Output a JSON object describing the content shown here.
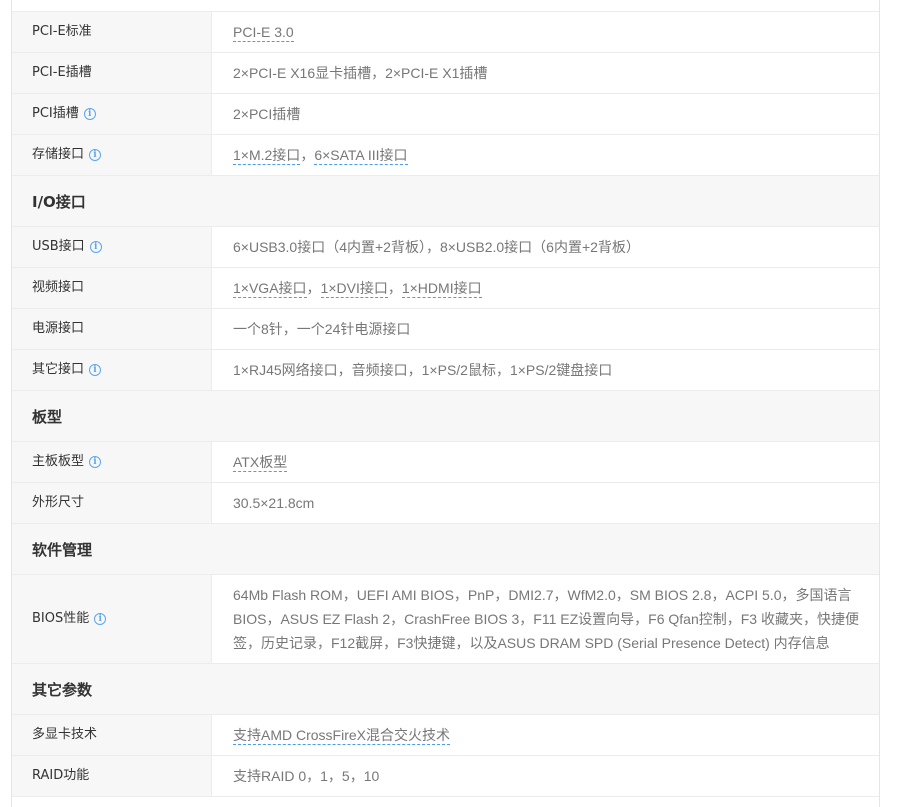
{
  "rows_top": [
    {
      "label": "PCI-E标准",
      "value": "PCI-E 3.0",
      "info": false
    },
    {
      "label": "PCI-E插槽",
      "value": "2×PCI-E X16显卡插槽，2×PCI-E X1插槽",
      "info": false
    },
    {
      "label": "PCI插槽",
      "value": "2×PCI插槽",
      "info": true
    },
    {
      "label": "存储接口",
      "value_links": [
        "1×M.2接口",
        "6×SATA III接口"
      ],
      "separator": "，",
      "info": true
    }
  ],
  "section_io": {
    "title": "I/O接口",
    "rows": [
      {
        "label": "USB接口",
        "value": "6×USB3.0接口（4内置+2背板），8×USB2.0接口（6内置+2背板）",
        "info": true
      },
      {
        "label": "视频接口",
        "value_links": [
          "1×VGA接口",
          "1×DVI接口",
          "1×HDMI接口"
        ],
        "separator": "，",
        "info": false
      },
      {
        "label": "电源接口",
        "value": "一个8针，一个24针电源接口",
        "info": false
      },
      {
        "label": "其它接口",
        "value": "1×RJ45网络接口，音频接口，1×PS/2鼠标，1×PS/2键盘接口",
        "info": true
      }
    ]
  },
  "section_board": {
    "title": "板型",
    "rows": [
      {
        "label": "主板板型",
        "value": "ATX板型",
        "info": true
      },
      {
        "label": "外形尺寸",
        "value": "30.5×21.8cm",
        "info": false
      }
    ]
  },
  "section_software": {
    "title": "软件管理",
    "rows": [
      {
        "label": "BIOS性能",
        "value": "64Mb Flash ROM，UEFI AMI BIOS，PnP，DMI2.7，WfM2.0，SM BIOS 2.8，ACPI 5.0，多国语言BIOS，ASUS EZ Flash 2，CrashFree BIOS 3，F11 EZ设置向导，F6 Qfan控制，F3 收藏夹，快捷便签，历史记录，F12截屏，F3快捷键，以及ASUS DRAM SPD (Serial Presence Detect) 内存信息",
        "info": true
      }
    ]
  },
  "section_other": {
    "title": "其它参数",
    "rows": [
      {
        "label": "多显卡技术",
        "value": "支持AMD CrossFireX混合交火技术",
        "info": false
      },
      {
        "label": "RAID功能",
        "value": "支持RAID 0，1，5，10",
        "info": false
      }
    ]
  },
  "icons": {
    "info": "i"
  },
  "colors": {
    "link_underline": "#4a9de8",
    "info_icon": "#5aa6f0",
    "label_bg": "#f7f7f7"
  }
}
